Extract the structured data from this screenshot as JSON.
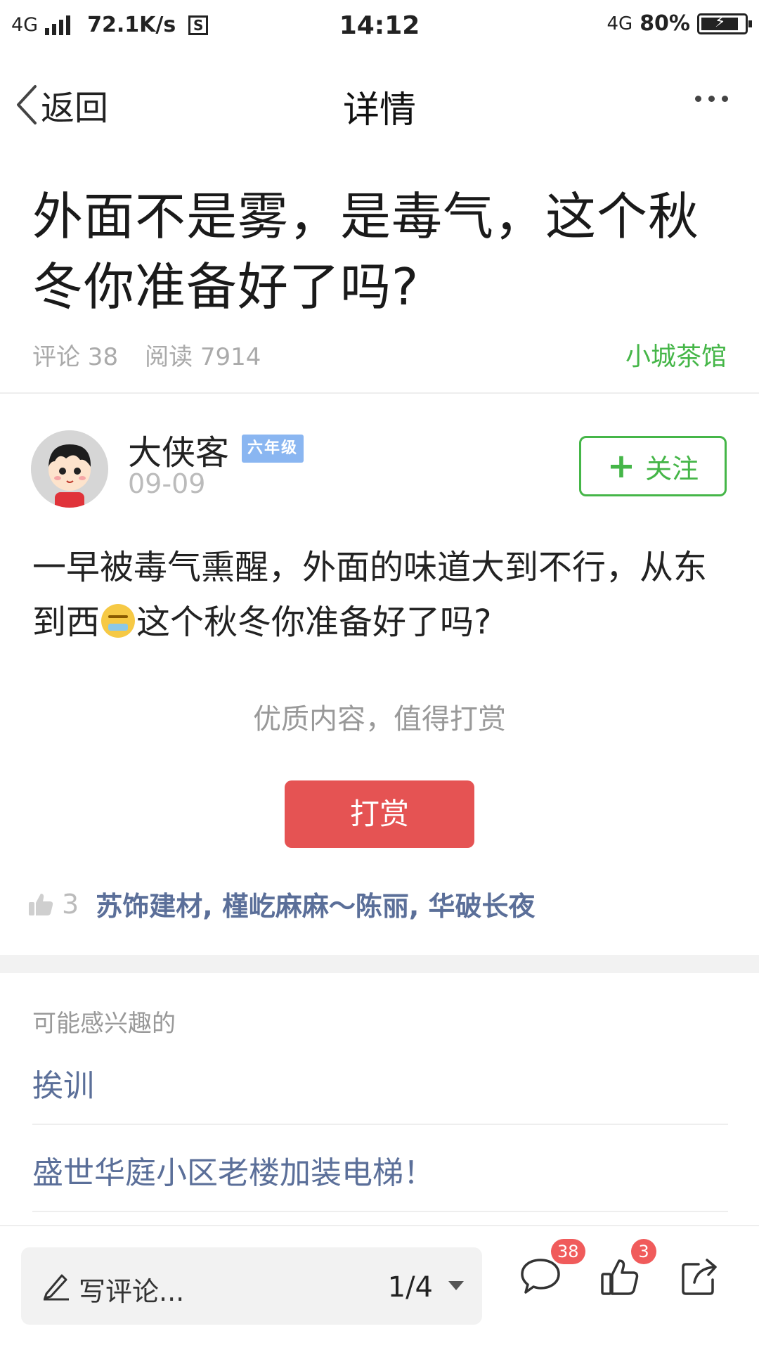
{
  "status_bar": {
    "network_left": "4G",
    "speed": "72.1K/s",
    "s_icon_label": "S",
    "time": "14:12",
    "network_right": "4G",
    "battery": "80%"
  },
  "nav": {
    "back_label": "返回",
    "title": "详情"
  },
  "article": {
    "title": "外面不是雾，是毒气，这个秋冬你准备好了吗?",
    "comments_label": "评论 38",
    "reads_label": "阅读 7914",
    "channel": "小城茶馆"
  },
  "author": {
    "name": "大侠客",
    "level": "六年级",
    "date": "09-09",
    "follow_label": "关注"
  },
  "post": {
    "text_before_emoji": "一早被毒气熏醒，外面的味道大到不行，从东到西",
    "text_after_emoji": "这个秋冬你准备好了吗?"
  },
  "reward": {
    "tip": "优质内容，值得打赏",
    "button_label": "打赏"
  },
  "likes": {
    "count": "3",
    "users": "苏饰建材, 槿屹麻麻～陈丽, 华破长夜"
  },
  "recommend": {
    "label": "可能感兴趣的",
    "items": [
      "挨训",
      "盛世华庭小区老楼加装电梯！"
    ]
  },
  "bottom_bar": {
    "comment_placeholder": "写评论...",
    "pager": "1/4",
    "comment_badge": "38",
    "like_badge": "3"
  },
  "colors": {
    "accent_green": "#45b648",
    "reward_red": "#e55353",
    "link_blue": "#5b6f99",
    "badge_red": "#f05b5b",
    "level_badge_blue": "#8ab6f1"
  }
}
